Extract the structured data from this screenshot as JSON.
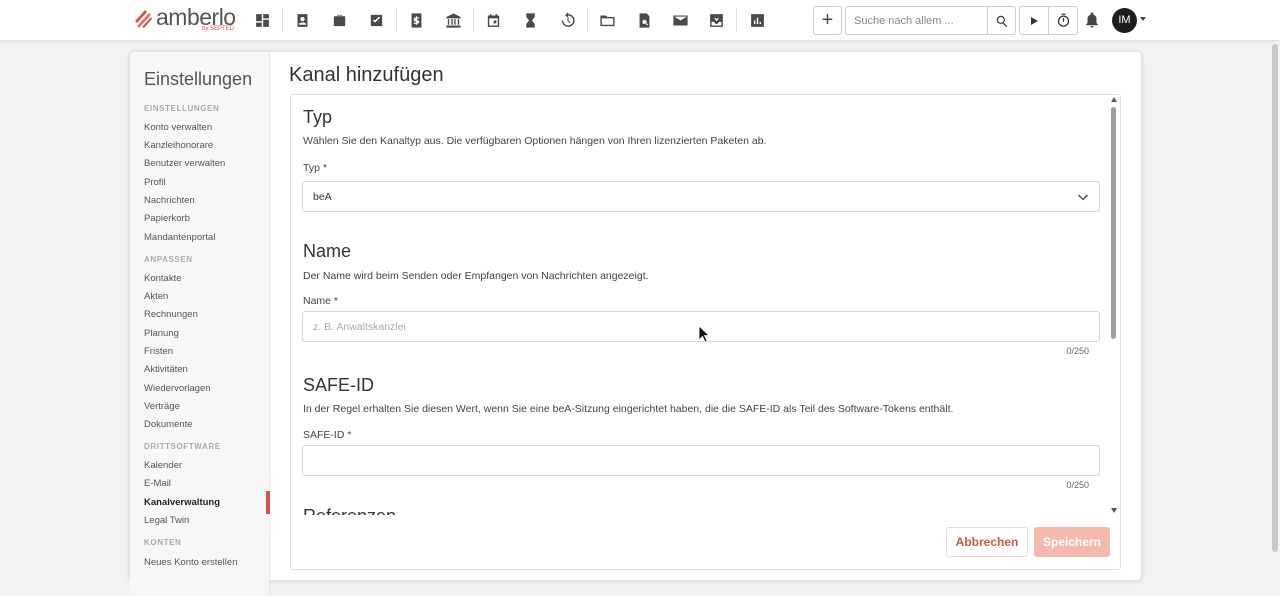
{
  "brand": {
    "name": "amberlo",
    "by": "by SEPTED",
    "accent": "#d9534f"
  },
  "topbar": {
    "nav_icons": [
      "dashboard-icon",
      "contacts-icon",
      "briefcase-icon",
      "tasks-icon",
      "invoice-icon",
      "bank-icon",
      "calendar-icon",
      "hourglass-icon",
      "history-icon",
      "folder-icon",
      "document-search-icon",
      "mail-icon",
      "inbox-icon",
      "reports-icon"
    ],
    "search_placeholder": "Suche nach allem ...",
    "avatar_initials": "IM"
  },
  "sidebar": {
    "title": "Einstellungen",
    "groups": [
      {
        "heading": "EINSTELLUNGEN",
        "items": [
          "Konto verwalten",
          "Kanzleihonorare",
          "Benutzer verwalten",
          "Profil",
          "Nachrichten",
          "Papierkorb",
          "Mandantenportal"
        ]
      },
      {
        "heading": "ANPASSEN",
        "items": [
          "Kontakte",
          "Akten",
          "Rechnungen",
          "Planung",
          "Fristen",
          "Aktivitäten",
          "Wiedervorlagen",
          "Verträge",
          "Dokumente"
        ]
      },
      {
        "heading": "DRITTSOFTWARE",
        "items": [
          "Kalender",
          "E-Mail",
          "Kanalverwaltung",
          "Legal Twin"
        ]
      },
      {
        "heading": "KONTEN",
        "items": [
          "Neues Konto erstellen"
        ]
      }
    ],
    "active_item": "Kanalverwaltung"
  },
  "main": {
    "title": "Kanal hinzufügen",
    "sections": {
      "typ": {
        "heading": "Typ",
        "description": "Wählen Sie den Kanaltyp aus. Die verfügbaren Optionen hängen von Ihren lizenzierten Paketen ab.",
        "label": "Typ *",
        "value": "beA"
      },
      "name": {
        "heading": "Name",
        "description": "Der Name wird beim Senden oder Empfangen von Nachrichten angezeigt.",
        "label": "Name *",
        "placeholder": "z. B. Anwaltskanzlei",
        "counter": "0/250"
      },
      "safe_id": {
        "heading": "SAFE-ID",
        "description": "In der Regel erhalten Sie diesen Wert, wenn Sie eine beA-Sitzung eingerichtet haben, die die SAFE-ID als Teil des Software-Tokens enthält.",
        "label": "SAFE-ID *",
        "value": "",
        "counter": "0/250"
      },
      "next": {
        "heading": "Referenzen"
      }
    },
    "buttons": {
      "cancel": "Abbrechen",
      "save": "Speichern"
    }
  }
}
